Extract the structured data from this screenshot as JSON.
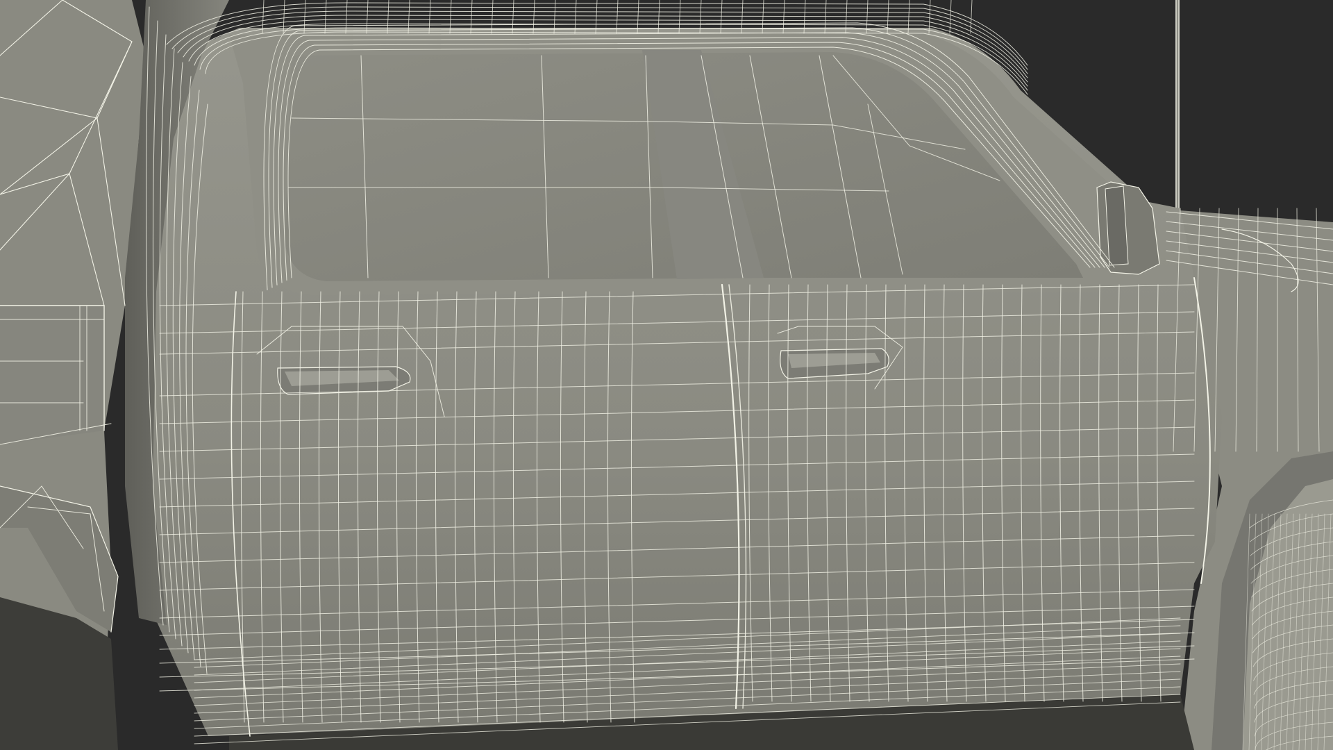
{
  "scene": {
    "subject": "wireframe-pickup-truck-side",
    "colors": {
      "background": "#2a2a2a",
      "body": "#8b8b82",
      "body_dark": "#6f6f68",
      "body_light": "#9a9a91",
      "glass": "#828279",
      "wire": "#f2f2e6",
      "shadow": "#3a3a36"
    }
  }
}
